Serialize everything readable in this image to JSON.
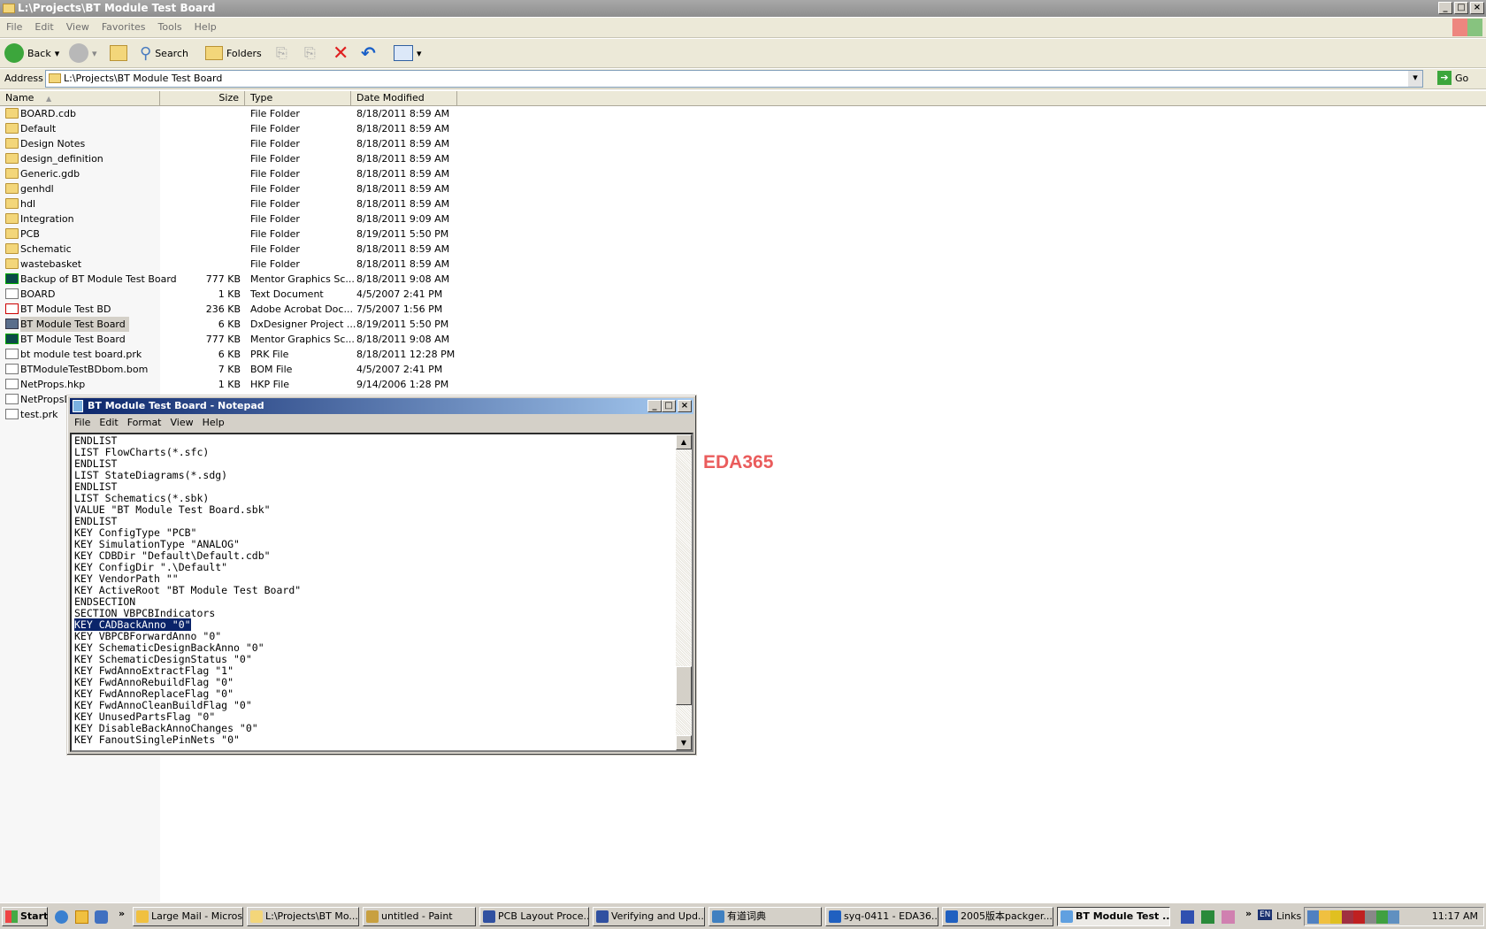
{
  "explorer": {
    "title": "L:\\Projects\\BT Module Test Board",
    "menu": [
      "File",
      "Edit",
      "View",
      "Favorites",
      "Tools",
      "Help"
    ],
    "toolbar": {
      "back": "Back",
      "search": "Search",
      "folders": "Folders"
    },
    "address_label": "Address",
    "address_value": "L:\\Projects\\BT Module Test Board",
    "go": "Go",
    "columns": {
      "name": "Name",
      "size": "Size",
      "type": "Type",
      "date": "Date Modified"
    },
    "files": [
      {
        "name": "BOARD.cdb",
        "size": "",
        "type": "File Folder",
        "date": "8/18/2011 8:59 AM",
        "icon": "folder"
      },
      {
        "name": "Default",
        "size": "",
        "type": "File Folder",
        "date": "8/18/2011 8:59 AM",
        "icon": "folder"
      },
      {
        "name": "Design Notes",
        "size": "",
        "type": "File Folder",
        "date": "8/18/2011 8:59 AM",
        "icon": "folder"
      },
      {
        "name": "design_definition",
        "size": "",
        "type": "File Folder",
        "date": "8/18/2011 8:59 AM",
        "icon": "folder"
      },
      {
        "name": "Generic.gdb",
        "size": "",
        "type": "File Folder",
        "date": "8/18/2011 8:59 AM",
        "icon": "folder"
      },
      {
        "name": "genhdl",
        "size": "",
        "type": "File Folder",
        "date": "8/18/2011 8:59 AM",
        "icon": "folder"
      },
      {
        "name": "hdl",
        "size": "",
        "type": "File Folder",
        "date": "8/18/2011 8:59 AM",
        "icon": "folder"
      },
      {
        "name": "Integration",
        "size": "",
        "type": "File Folder",
        "date": "8/18/2011 9:09 AM",
        "icon": "folder"
      },
      {
        "name": "PCB",
        "size": "",
        "type": "File Folder",
        "date": "8/19/2011 5:50 PM",
        "icon": "folder"
      },
      {
        "name": "Schematic",
        "size": "",
        "type": "File Folder",
        "date": "8/18/2011 8:59 AM",
        "icon": "folder"
      },
      {
        "name": "wastebasket",
        "size": "",
        "type": "File Folder",
        "date": "8/18/2011 8:59 AM",
        "icon": "folder"
      },
      {
        "name": "Backup of BT Module Test Board",
        "size": "777 KB",
        "type": "Mentor Graphics Sc...",
        "date": "8/18/2011 9:08 AM",
        "icon": "mentor"
      },
      {
        "name": "BOARD",
        "size": "1 KB",
        "type": "Text Document",
        "date": "4/5/2007 2:41 PM",
        "icon": "doc"
      },
      {
        "name": "BT Module Test BD",
        "size": "236 KB",
        "type": "Adobe Acrobat Doc...",
        "date": "7/5/2007 1:56 PM",
        "icon": "pdf"
      },
      {
        "name": "BT Module Test Board",
        "size": "6 KB",
        "type": "DxDesigner Project ...",
        "date": "8/19/2011 5:50 PM",
        "icon": "dx",
        "selected": true
      },
      {
        "name": "BT Module Test Board",
        "size": "777 KB",
        "type": "Mentor Graphics Sc...",
        "date": "8/18/2011 9:08 AM",
        "icon": "mentor"
      },
      {
        "name": "bt module test board.prk",
        "size": "6 KB",
        "type": "PRK File",
        "date": "8/18/2011 12:28 PM",
        "icon": "doc"
      },
      {
        "name": "BTModuleTestBDbom.bom",
        "size": "7 KB",
        "type": "BOM File",
        "date": "4/5/2007 2:41 PM",
        "icon": "doc"
      },
      {
        "name": "NetProps.hkp",
        "size": "1 KB",
        "type": "HKP File",
        "date": "9/14/2006 1:28 PM",
        "icon": "doc"
      },
      {
        "name": "NetPropsD",
        "size": "",
        "type": "",
        "date": "",
        "icon": "doc"
      },
      {
        "name": "test.prk",
        "size": "",
        "type": "",
        "date": "",
        "icon": "doc"
      }
    ]
  },
  "notepad": {
    "title": "BT Module Test Board - Notepad",
    "menu": [
      "File",
      "Edit",
      "Format",
      "View",
      "Help"
    ],
    "selected_line": 16,
    "lines": [
      "ENDLIST",
      "LIST FlowCharts(*.sfc)",
      "ENDLIST",
      "LIST StateDiagrams(*.sdg)",
      "ENDLIST",
      "LIST Schematics(*.sbk)",
      "VALUE \"BT Module Test Board.sbk\"",
      "ENDLIST",
      "KEY ConfigType \"PCB\"",
      "KEY SimulationType \"ANALOG\"",
      "KEY CDBDir \"Default\\Default.cdb\"",
      "KEY ConfigDir \".\\Default\"",
      "KEY VendorPath \"\"",
      "KEY ActiveRoot \"BT Module Test Board\"",
      "ENDSECTION",
      "SECTION VBPCBIndicators",
      "KEY CADBackAnno \"0\"",
      "KEY VBPCBForwardAnno \"0\"",
      "KEY SchematicDesignBackAnno \"0\"",
      "KEY SchematicDesignStatus \"0\"",
      "KEY FwdAnnoExtractFlag \"1\"",
      "KEY FwdAnnoRebuildFlag \"0\"",
      "KEY FwdAnnoReplaceFlag \"0\"",
      "KEY FwdAnnoCleanBuildFlag \"0\"",
      "KEY UnusedPartsFlag \"0\"",
      "KEY DisableBackAnnoChanges \"0\"",
      "KEY FanoutSinglePinNets \"0\""
    ]
  },
  "watermark": "EDA365",
  "taskbar": {
    "start": "Start",
    "tasks": [
      {
        "label": "Large Mail - Micros...",
        "color": "#f0c040"
      },
      {
        "label": "L:\\Projects\\BT Mo...",
        "color": "#f3d67a"
      },
      {
        "label": "untitled - Paint",
        "color": "#c8a040"
      },
      {
        "label": "PCB Layout Proce...",
        "color": "#3050a0"
      },
      {
        "label": "Verifying and Upd...",
        "color": "#3050a0"
      },
      {
        "label": "有道词典",
        "color": "#4080c0"
      },
      {
        "label": "syq-0411 - EDA36...",
        "color": "#2060c0"
      },
      {
        "label": "2005版本packger...",
        "color": "#2060c0"
      },
      {
        "label": "BT Module Test ...",
        "color": "#60a0e0",
        "active": true
      }
    ],
    "links": "Links",
    "lang": "EN",
    "clock": "11:17 AM"
  }
}
